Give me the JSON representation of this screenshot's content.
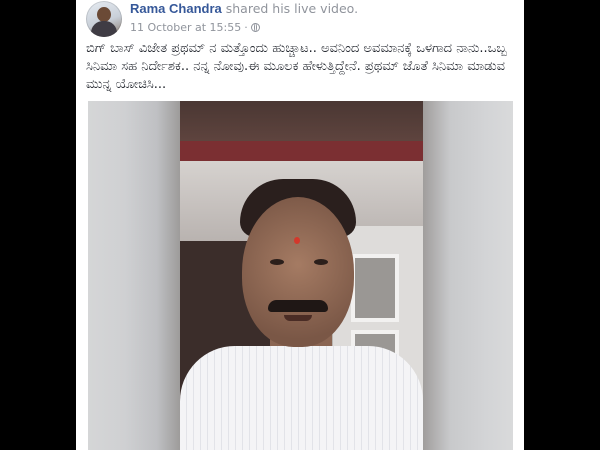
{
  "post": {
    "author": "Rama Chandra",
    "action": "shared his live video.",
    "timestamp": "11 October at 15:55",
    "separator": "·",
    "privacy_icon": "globe-icon",
    "text": "ಬಿಗ್ ಬಾಸ್ ವಿಜೇತ ಪ್ರಥಮ್ ನ ಮತ್ತೊಂದು ಹುಚ್ಚಾಟ.. ಅವನಿಂದ ಅವಮಾನಕ್ಕೆ ಒಳಗಾದ ನಾನು..ಒಬ್ಬ ಸಿನಿಮಾ ಸಹ ನಿರ್ದೇಶಕ.. ನನ್ನ ನೋವು.ಈ ಮೂಲಕ ಹೇಳುತ್ತಿದ್ದೇನೆ. ಪ್ರಥಮ್ ಜೊತೆ ಸಿನಿಮಾ ಮಾಡುವ ಮುನ್ನ ಯೋಚಿಸಿ..."
  },
  "colors": {
    "author_link": "#365899",
    "meta_text": "#90949c",
    "body_text": "#1d2129",
    "backdrop": "#000000"
  }
}
